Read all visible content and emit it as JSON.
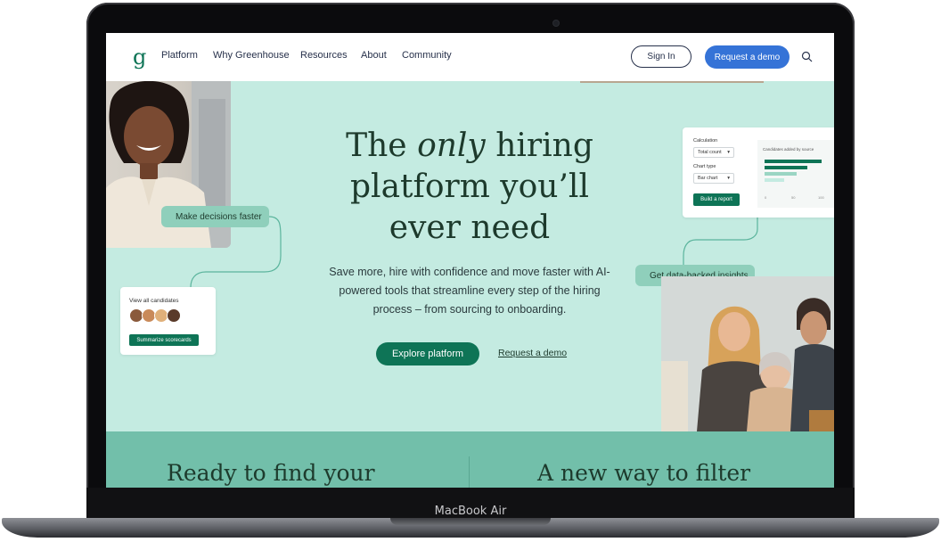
{
  "device": {
    "label": "MacBook Air"
  },
  "nav": {
    "logo": "g",
    "links": [
      "Platform",
      "Why Greenhouse",
      "Resources",
      "About",
      "Community"
    ],
    "sign_in": "Sign In",
    "request_demo": "Request a demo",
    "search_icon": "search-icon"
  },
  "hero": {
    "title_pre": "The ",
    "title_em": "only",
    "title_post": " hiring platform you’ll ever need",
    "subtitle": "Save more, hire with confidence and move faster with AI-powered tools that streamline every step of the hiring process – from sourcing to onboarding.",
    "explore_button": "Explore platform",
    "demo_link": "Request a demo"
  },
  "widgets": {
    "decisions_pill": "Make decisions faster",
    "insights_pill": "Get data-backed insights",
    "candidates_card": {
      "title": "View all candidates",
      "button": "Summarize scorecards"
    },
    "report_card": {
      "calculation_label": "Calculation",
      "calculation_value": "Total count",
      "chart_type_label": "Chart type",
      "chart_type_value": "Bar chart",
      "button": "Build a report",
      "chart_title": "Candidates added by source",
      "axis_ticks": [
        "0",
        "50",
        "100"
      ]
    }
  },
  "bottom": {
    "left_heading": "Ready to find your",
    "right_heading": "A new way to filter"
  },
  "colors": {
    "brand_green": "#0e7456",
    "hero_bg": "#c4ebe1",
    "band_bg": "#72bfaa",
    "demo_blue": "#3573d7",
    "text_dark": "#1d3a2c"
  }
}
